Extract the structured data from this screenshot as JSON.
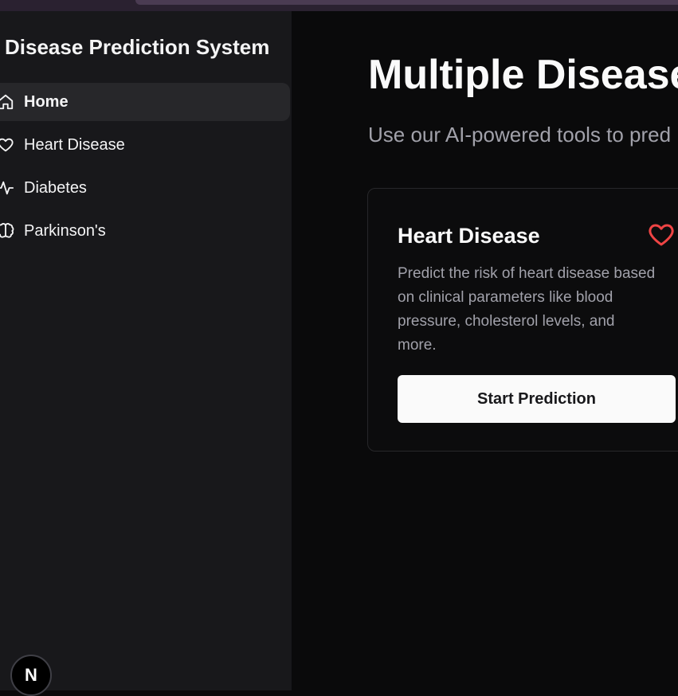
{
  "sidebar": {
    "brand": "Disease Prediction System",
    "items": [
      {
        "label": "Home",
        "icon": "home-icon",
        "active": true
      },
      {
        "label": "Heart Disease",
        "icon": "heart-icon"
      },
      {
        "label": "Diabetes",
        "icon": "activity-icon"
      },
      {
        "label": "Parkinson's",
        "icon": "brain-icon"
      }
    ],
    "badge": "N"
  },
  "main": {
    "title": "Multiple Disease",
    "subtitle": "Use our AI-powered tools to pred",
    "card": {
      "title": "Heart Disease",
      "icon": "heart-icon",
      "description": "Predict the risk of heart disease based on clinical parameters like blood pressure, cholesterol levels, and more.",
      "button": "Start Prediction"
    }
  },
  "colors": {
    "background": "#0a0a0b",
    "sidebar": "#18181b",
    "active_item": "#27272a",
    "accent_heart": "#ef4444",
    "button_bg": "#fafafa"
  }
}
